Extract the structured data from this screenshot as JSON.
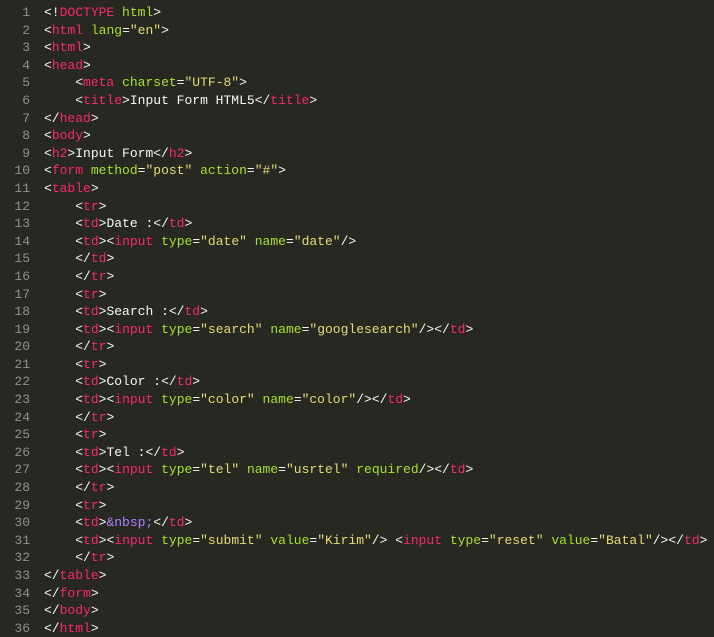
{
  "lines": [
    {
      "n": 1,
      "tokens": [
        [
          "br",
          "<!"
        ],
        [
          "tag",
          "DOCTYPE"
        ],
        [
          "ws",
          " "
        ],
        [
          "attr",
          "html"
        ],
        [
          "br",
          ">"
        ]
      ]
    },
    {
      "n": 2,
      "tokens": [
        [
          "br",
          "<"
        ],
        [
          "tag",
          "html"
        ],
        [
          "ws",
          " "
        ],
        [
          "attr",
          "lang"
        ],
        [
          "br",
          "="
        ],
        [
          "val",
          "\"en\""
        ],
        [
          "br",
          ">"
        ]
      ]
    },
    {
      "n": 3,
      "tokens": [
        [
          "br",
          "<"
        ],
        [
          "tag",
          "html"
        ],
        [
          "br",
          ">"
        ]
      ]
    },
    {
      "n": 4,
      "tokens": [
        [
          "br",
          "<"
        ],
        [
          "tag",
          "head"
        ],
        [
          "br",
          ">"
        ]
      ]
    },
    {
      "n": 5,
      "tokens": [
        [
          "ws",
          "    "
        ],
        [
          "br",
          "<"
        ],
        [
          "tag",
          "meta"
        ],
        [
          "ws",
          " "
        ],
        [
          "attr",
          "charset"
        ],
        [
          "br",
          "="
        ],
        [
          "val",
          "\"UTF-8\""
        ],
        [
          "br",
          ">"
        ]
      ]
    },
    {
      "n": 6,
      "tokens": [
        [
          "ws",
          "    "
        ],
        [
          "br",
          "<"
        ],
        [
          "tag",
          "title"
        ],
        [
          "br",
          ">"
        ],
        [
          "txt",
          "Input Form HTML5"
        ],
        [
          "br",
          "</"
        ],
        [
          "tag",
          "title"
        ],
        [
          "br",
          ">"
        ]
      ]
    },
    {
      "n": 7,
      "tokens": [
        [
          "br",
          "</"
        ],
        [
          "tag",
          "head"
        ],
        [
          "br",
          ">"
        ]
      ]
    },
    {
      "n": 8,
      "tokens": [
        [
          "br",
          "<"
        ],
        [
          "tag",
          "body"
        ],
        [
          "br",
          ">"
        ]
      ]
    },
    {
      "n": 9,
      "tokens": [
        [
          "br",
          "<"
        ],
        [
          "tag",
          "h2"
        ],
        [
          "br",
          ">"
        ],
        [
          "txt",
          "Input Form"
        ],
        [
          "br",
          "</"
        ],
        [
          "tag",
          "h2"
        ],
        [
          "br",
          ">"
        ]
      ]
    },
    {
      "n": 10,
      "tokens": [
        [
          "br",
          "<"
        ],
        [
          "tag",
          "form"
        ],
        [
          "ws",
          " "
        ],
        [
          "attr",
          "method"
        ],
        [
          "br",
          "="
        ],
        [
          "val",
          "\"post\""
        ],
        [
          "ws",
          " "
        ],
        [
          "attr",
          "action"
        ],
        [
          "br",
          "="
        ],
        [
          "val",
          "\"#\""
        ],
        [
          "br",
          ">"
        ]
      ]
    },
    {
      "n": 11,
      "tokens": [
        [
          "br",
          "<"
        ],
        [
          "tag",
          "table"
        ],
        [
          "br",
          ">"
        ]
      ]
    },
    {
      "n": 12,
      "tokens": [
        [
          "ws",
          "    "
        ],
        [
          "br",
          "<"
        ],
        [
          "tag",
          "tr"
        ],
        [
          "br",
          ">"
        ]
      ]
    },
    {
      "n": 13,
      "tokens": [
        [
          "ws",
          "    "
        ],
        [
          "br",
          "<"
        ],
        [
          "tag",
          "td"
        ],
        [
          "br",
          ">"
        ],
        [
          "txt",
          "Date :"
        ],
        [
          "br",
          "</"
        ],
        [
          "tag",
          "td"
        ],
        [
          "br",
          ">"
        ]
      ]
    },
    {
      "n": 14,
      "tokens": [
        [
          "ws",
          "    "
        ],
        [
          "br",
          "<"
        ],
        [
          "tag",
          "td"
        ],
        [
          "br",
          ">"
        ],
        [
          "br",
          "<"
        ],
        [
          "tag",
          "input"
        ],
        [
          "ws",
          " "
        ],
        [
          "attr",
          "type"
        ],
        [
          "br",
          "="
        ],
        [
          "val",
          "\"date\""
        ],
        [
          "ws",
          " "
        ],
        [
          "attr",
          "name"
        ],
        [
          "br",
          "="
        ],
        [
          "val",
          "\"date\""
        ],
        [
          "br",
          "/>"
        ]
      ]
    },
    {
      "n": 15,
      "tokens": [
        [
          "ws",
          "    "
        ],
        [
          "br",
          "</"
        ],
        [
          "tag",
          "td"
        ],
        [
          "br",
          ">"
        ]
      ]
    },
    {
      "n": 16,
      "tokens": [
        [
          "ws",
          "    "
        ],
        [
          "br",
          "</"
        ],
        [
          "tag",
          "tr"
        ],
        [
          "br",
          ">"
        ]
      ]
    },
    {
      "n": 17,
      "tokens": [
        [
          "ws",
          "    "
        ],
        [
          "br",
          "<"
        ],
        [
          "tag",
          "tr"
        ],
        [
          "br",
          ">"
        ]
      ]
    },
    {
      "n": 18,
      "tokens": [
        [
          "ws",
          "    "
        ],
        [
          "br",
          "<"
        ],
        [
          "tag",
          "td"
        ],
        [
          "br",
          ">"
        ],
        [
          "txt",
          "Search :"
        ],
        [
          "br",
          "</"
        ],
        [
          "tag",
          "td"
        ],
        [
          "br",
          ">"
        ]
      ]
    },
    {
      "n": 19,
      "tokens": [
        [
          "ws",
          "    "
        ],
        [
          "br",
          "<"
        ],
        [
          "tag",
          "td"
        ],
        [
          "br",
          ">"
        ],
        [
          "br",
          "<"
        ],
        [
          "tag",
          "input"
        ],
        [
          "ws",
          " "
        ],
        [
          "attr",
          "type"
        ],
        [
          "br",
          "="
        ],
        [
          "val",
          "\"search\""
        ],
        [
          "ws",
          " "
        ],
        [
          "attr",
          "name"
        ],
        [
          "br",
          "="
        ],
        [
          "val",
          "\"googlesearch\""
        ],
        [
          "br",
          "/></"
        ],
        [
          "tag",
          "td"
        ],
        [
          "br",
          ">"
        ]
      ]
    },
    {
      "n": 20,
      "tokens": [
        [
          "ws",
          "    "
        ],
        [
          "br",
          "</"
        ],
        [
          "tag",
          "tr"
        ],
        [
          "br",
          ">"
        ]
      ]
    },
    {
      "n": 21,
      "tokens": [
        [
          "ws",
          "    "
        ],
        [
          "br",
          "<"
        ],
        [
          "tag",
          "tr"
        ],
        [
          "br",
          ">"
        ]
      ]
    },
    {
      "n": 22,
      "tokens": [
        [
          "ws",
          "    "
        ],
        [
          "br",
          "<"
        ],
        [
          "tag",
          "td"
        ],
        [
          "br",
          ">"
        ],
        [
          "txt",
          "Color :"
        ],
        [
          "br",
          "</"
        ],
        [
          "tag",
          "td"
        ],
        [
          "br",
          ">"
        ]
      ]
    },
    {
      "n": 23,
      "tokens": [
        [
          "ws",
          "    "
        ],
        [
          "br",
          "<"
        ],
        [
          "tag",
          "td"
        ],
        [
          "br",
          ">"
        ],
        [
          "br",
          "<"
        ],
        [
          "tag",
          "input"
        ],
        [
          "ws",
          " "
        ],
        [
          "attr",
          "type"
        ],
        [
          "br",
          "="
        ],
        [
          "val",
          "\"color\""
        ],
        [
          "ws",
          " "
        ],
        [
          "attr",
          "name"
        ],
        [
          "br",
          "="
        ],
        [
          "val",
          "\"color\""
        ],
        [
          "br",
          "/></"
        ],
        [
          "tag",
          "td"
        ],
        [
          "br",
          ">"
        ]
      ]
    },
    {
      "n": 24,
      "tokens": [
        [
          "ws",
          "    "
        ],
        [
          "br",
          "</"
        ],
        [
          "tag",
          "tr"
        ],
        [
          "br",
          ">"
        ]
      ]
    },
    {
      "n": 25,
      "tokens": [
        [
          "ws",
          "    "
        ],
        [
          "br",
          "<"
        ],
        [
          "tag",
          "tr"
        ],
        [
          "br",
          ">"
        ]
      ]
    },
    {
      "n": 26,
      "tokens": [
        [
          "ws",
          "    "
        ],
        [
          "br",
          "<"
        ],
        [
          "tag",
          "td"
        ],
        [
          "br",
          ">"
        ],
        [
          "txt",
          "Tel :"
        ],
        [
          "br",
          "</"
        ],
        [
          "tag",
          "td"
        ],
        [
          "br",
          ">"
        ]
      ]
    },
    {
      "n": 27,
      "tokens": [
        [
          "ws",
          "    "
        ],
        [
          "br",
          "<"
        ],
        [
          "tag",
          "td"
        ],
        [
          "br",
          ">"
        ],
        [
          "br",
          "<"
        ],
        [
          "tag",
          "input"
        ],
        [
          "ws",
          " "
        ],
        [
          "attr",
          "type"
        ],
        [
          "br",
          "="
        ],
        [
          "val",
          "\"tel\""
        ],
        [
          "ws",
          " "
        ],
        [
          "attr",
          "name"
        ],
        [
          "br",
          "="
        ],
        [
          "val",
          "\"usrtel\""
        ],
        [
          "ws",
          " "
        ],
        [
          "attr",
          "required"
        ],
        [
          "br",
          "/></"
        ],
        [
          "tag",
          "td"
        ],
        [
          "br",
          ">"
        ]
      ]
    },
    {
      "n": 28,
      "tokens": [
        [
          "ws",
          "    "
        ],
        [
          "br",
          "</"
        ],
        [
          "tag",
          "tr"
        ],
        [
          "br",
          ">"
        ]
      ]
    },
    {
      "n": 29,
      "tokens": [
        [
          "ws",
          "    "
        ],
        [
          "br",
          "<"
        ],
        [
          "tag",
          "tr"
        ],
        [
          "br",
          ">"
        ]
      ]
    },
    {
      "n": 30,
      "tokens": [
        [
          "ws",
          "    "
        ],
        [
          "br",
          "<"
        ],
        [
          "tag",
          "td"
        ],
        [
          "br",
          ">"
        ],
        [
          "ent",
          "&nbsp;"
        ],
        [
          "br",
          "</"
        ],
        [
          "tag",
          "td"
        ],
        [
          "br",
          ">"
        ]
      ]
    },
    {
      "n": 31,
      "tokens": [
        [
          "ws",
          "    "
        ],
        [
          "br",
          "<"
        ],
        [
          "tag",
          "td"
        ],
        [
          "br",
          ">"
        ],
        [
          "br",
          "<"
        ],
        [
          "tag",
          "input"
        ],
        [
          "ws",
          " "
        ],
        [
          "attr",
          "type"
        ],
        [
          "br",
          "="
        ],
        [
          "val",
          "\"submit\""
        ],
        [
          "ws",
          " "
        ],
        [
          "attr",
          "value"
        ],
        [
          "br",
          "="
        ],
        [
          "val",
          "\"Kirim\""
        ],
        [
          "br",
          "/>"
        ],
        [
          "ws",
          " "
        ],
        [
          "br",
          "<"
        ],
        [
          "tag",
          "input"
        ],
        [
          "ws",
          " "
        ],
        [
          "attr",
          "type"
        ],
        [
          "br",
          "="
        ],
        [
          "val",
          "\"reset\""
        ],
        [
          "ws",
          " "
        ],
        [
          "attr",
          "value"
        ],
        [
          "br",
          "="
        ],
        [
          "val",
          "\"Batal\""
        ],
        [
          "br",
          "/></"
        ],
        [
          "tag",
          "td"
        ],
        [
          "br",
          ">"
        ]
      ]
    },
    {
      "n": 32,
      "tokens": [
        [
          "ws",
          "    "
        ],
        [
          "br",
          "</"
        ],
        [
          "tag",
          "tr"
        ],
        [
          "br",
          ">"
        ]
      ]
    },
    {
      "n": 33,
      "tokens": [
        [
          "br",
          "</"
        ],
        [
          "tag",
          "table"
        ],
        [
          "br",
          ">"
        ]
      ]
    },
    {
      "n": 34,
      "tokens": [
        [
          "br",
          "</"
        ],
        [
          "tag",
          "form"
        ],
        [
          "br",
          ">"
        ]
      ]
    },
    {
      "n": 35,
      "tokens": [
        [
          "br",
          "</"
        ],
        [
          "tag",
          "body"
        ],
        [
          "br",
          ">"
        ]
      ]
    },
    {
      "n": 36,
      "tokens": [
        [
          "br",
          "</"
        ],
        [
          "tag",
          "html"
        ],
        [
          "br",
          ">"
        ]
      ]
    }
  ]
}
